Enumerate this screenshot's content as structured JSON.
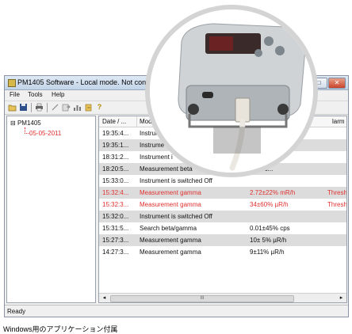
{
  "window": {
    "title": "PM1405 Software - Local mode. Not conn",
    "minimize": "–",
    "maximize": "□",
    "close": "✕"
  },
  "menu": [
    "File",
    "Tools",
    "Help"
  ],
  "toolbar": {
    "icons": [
      "open-folder-icon",
      "save-icon",
      "print-icon",
      "wand-icon",
      "export-icon",
      "chart-icon",
      "import-icon",
      "help-icon"
    ],
    "help_glyph": "?"
  },
  "tree": {
    "toggle": "⊟",
    "root": "PM1405",
    "child": "05-05-2011"
  },
  "table": {
    "headers": [
      "Date / ...",
      "Mode",
      "larm"
    ],
    "rows": [
      {
        "time": "19:35:4...",
        "mode": "Instrum",
        "value": "",
        "alarm": "",
        "alt": false,
        "red": false
      },
      {
        "time": "19:35:1...",
        "mode": "Instrume",
        "value": "",
        "alarm": "",
        "alt": true,
        "red": false
      },
      {
        "time": "18:31:2...",
        "mode": "Instrument i",
        "value": "",
        "alarm": "",
        "alt": false,
        "red": false
      },
      {
        "time": "18:20:5...",
        "mode": "Measurement beta",
        "value": "(min*c...",
        "alarm": "",
        "alt": true,
        "red": false
      },
      {
        "time": "15:33:0...",
        "mode": "Instrument is switched Off",
        "value": "",
        "alarm": "",
        "alt": false,
        "red": false
      },
      {
        "time": "15:32:4...",
        "mode": "Measurement gamma",
        "value": "2.72±22% mR/h",
        "alarm": "Thresh",
        "alt": true,
        "red": true
      },
      {
        "time": "15:32:3...",
        "mode": "Measurement gamma",
        "value": "34±60% µR/h",
        "alarm": "Thresh",
        "alt": false,
        "red": true
      },
      {
        "time": "15:32:0...",
        "mode": "Instrument is switched Off",
        "value": "",
        "alarm": "",
        "alt": true,
        "red": false
      },
      {
        "time": "15:31:5...",
        "mode": "Search beta/gamma",
        "value": "0.01±45% cps",
        "alarm": "",
        "alt": false,
        "red": false
      },
      {
        "time": "15:27:3...",
        "mode": "Measurement gamma",
        "value": "10± 5% µR/h",
        "alarm": "",
        "alt": true,
        "red": false
      },
      {
        "time": "14:27:3...",
        "mode": "Measurement gamma",
        "value": "9±11% µR/h",
        "alarm": "",
        "alt": false,
        "red": false
      }
    ],
    "scroll_left": "◂",
    "scroll_grip": "III",
    "scroll_right": "▸"
  },
  "status": "Ready",
  "caption": "Windows用のアプリケーション付属",
  "colors": {
    "alarm_red": "#e03030",
    "alt_row": "#dcdcdc"
  }
}
